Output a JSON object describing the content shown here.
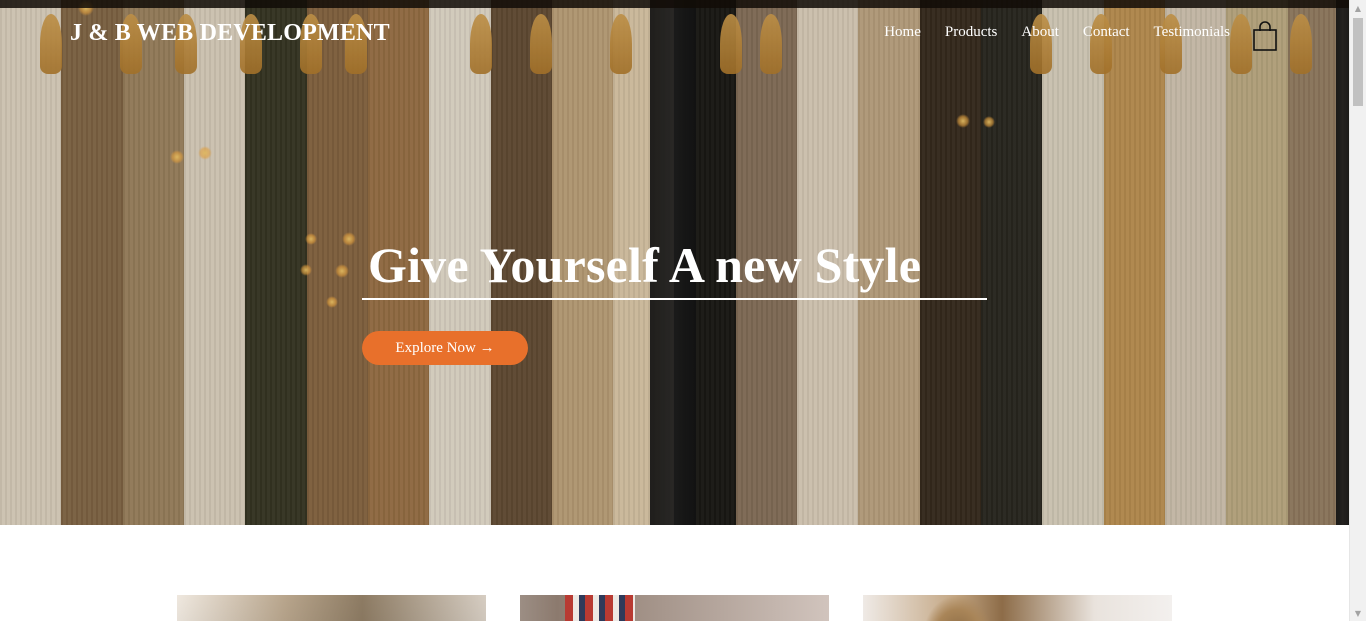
{
  "header": {
    "brand": "J & B WEB DEVELOPMENT",
    "nav": [
      {
        "label": "Home"
      },
      {
        "label": "Products"
      },
      {
        "label": "About"
      },
      {
        "label": "Contact"
      },
      {
        "label": "Testimonials"
      }
    ],
    "cart_icon": "shopping-bag-icon"
  },
  "hero": {
    "title": "Give Yourself A new Style",
    "cta_label": "Explore Now →",
    "image": "clothing-rack-photo"
  },
  "products": {
    "cards": [
      {
        "image": "product-photo-1"
      },
      {
        "image": "product-photo-2"
      },
      {
        "image": "product-photo-3"
      }
    ]
  },
  "colors": {
    "accent": "#e8702b",
    "text_on_hero": "#ffffff",
    "page_background": "#ffffff"
  }
}
